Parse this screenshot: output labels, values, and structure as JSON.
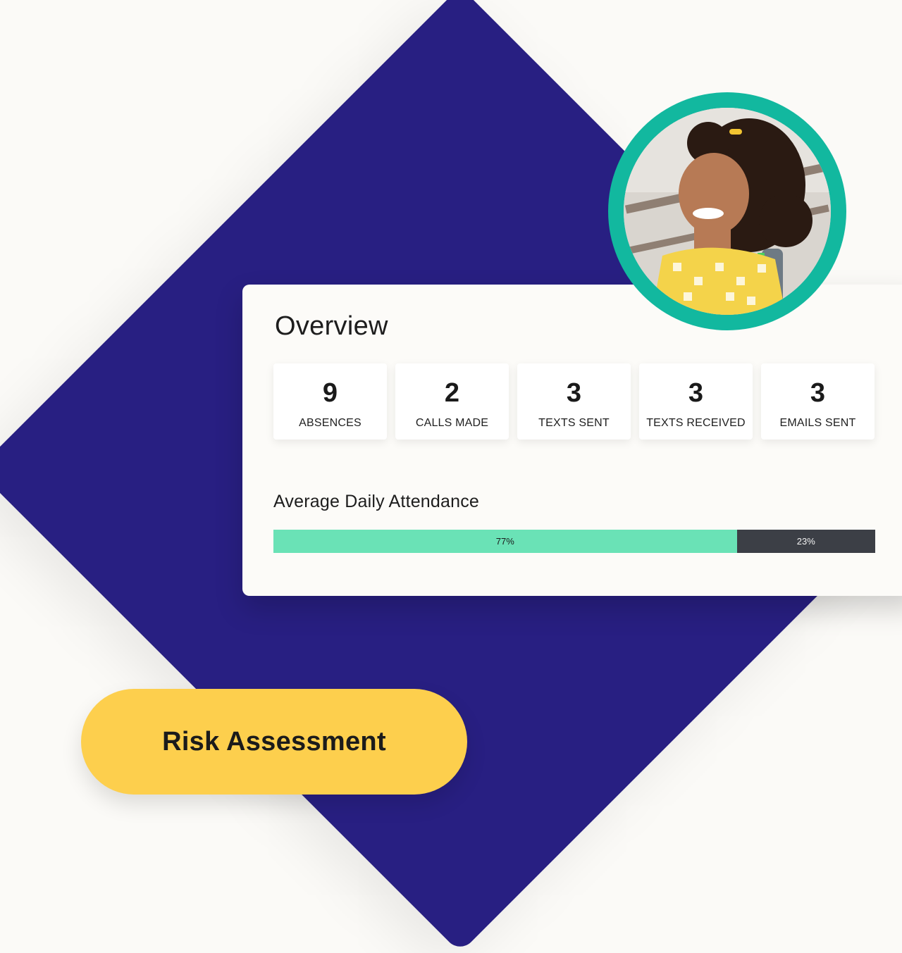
{
  "overview": {
    "title": "Overview",
    "stats": [
      {
        "value": "9",
        "label": "ABSENCES"
      },
      {
        "value": "2",
        "label": "CALLS MADE"
      },
      {
        "value": "3",
        "label": "TEXTS SENT"
      },
      {
        "value": "3",
        "label": "TEXTS RECEIVED"
      },
      {
        "value": "3",
        "label": "EMAILS SENT"
      }
    ]
  },
  "attendance": {
    "title": "Average Daily Attendance",
    "present_label": "77%",
    "absent_label": "23%",
    "present_fraction": 0.77,
    "present_color": "#6ae2b6",
    "absent_color": "#3c3f46"
  },
  "student": {
    "ring_color": "#12b89f"
  },
  "action": {
    "label": "Risk Assessment",
    "color": "#fdcf4d"
  },
  "colors": {
    "diamond": "#281f82",
    "background": "#fbfaf7"
  }
}
